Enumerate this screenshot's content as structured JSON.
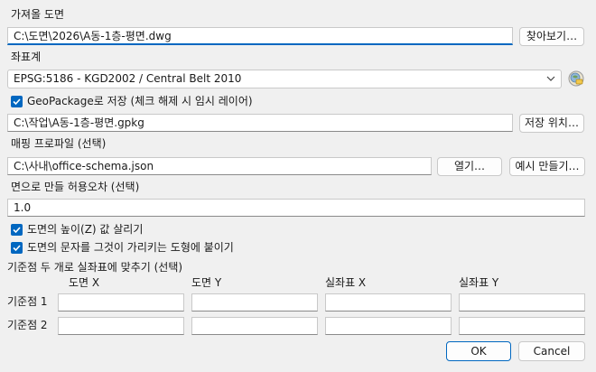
{
  "drawing": {
    "label": "가져올 도면",
    "path": "C:\\도면\\2026\\A동-1층-평면.dwg",
    "browse_button": "찾아보기…"
  },
  "crs": {
    "label": "좌표계",
    "selected": "EPSG:5186 - KGD2002 / Central Belt 2010",
    "picker_icon": "globe-crs-icon"
  },
  "geopackage": {
    "checkbox_label": "GeoPackage로 저장 (체크 해제 시 임시 레이어)",
    "checked": true,
    "path": "C:\\작업\\A동-1층-평면.gpkg",
    "save_location_button": "저장 위치…"
  },
  "mapping_profile": {
    "label": "매핑 프로파일 (선택)",
    "path": "C:\\사내\\office-schema.json",
    "open_button": "열기…",
    "example_button": "예시 만들기…"
  },
  "tolerance": {
    "label": "면으로 만들 허용오차 (선택)",
    "value": "1.0"
  },
  "options": {
    "keep_z_label": "도면의 높이(Z) 값 살리기",
    "keep_z_checked": true,
    "attach_text_label": "도면의 문자를 그것이 가리키는 도형에 붙이기",
    "attach_text_checked": true
  },
  "georef": {
    "label": "기준점 두 개로 실좌표에 맞추기 (선택)",
    "headers": [
      "도면 X",
      "도면 Y",
      "실좌표 X",
      "실좌표 Y"
    ],
    "rows": [
      {
        "label": "기준점 1",
        "values": [
          "",
          "",
          "",
          ""
        ]
      },
      {
        "label": "기준점 2",
        "values": [
          "",
          "",
          "",
          ""
        ]
      }
    ]
  },
  "dialog": {
    "ok_button": "OK",
    "cancel_button": "Cancel"
  },
  "colors": {
    "accent": "#0067c0",
    "background": "#f0f0f0"
  }
}
